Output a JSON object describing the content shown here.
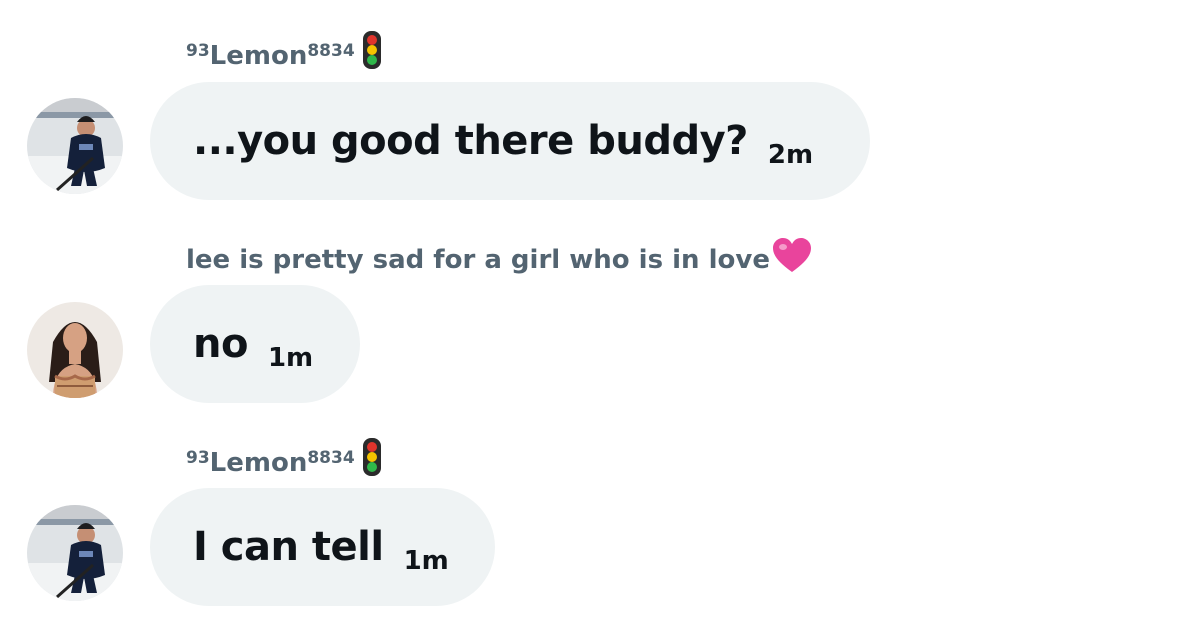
{
  "messages": [
    {
      "sender": {
        "prefix": "93",
        "name": "Lemon",
        "suffix": "8834",
        "emoji": "traffic-light-icon"
      },
      "avatar": "hockey-player-avatar",
      "text": "...you good there buddy?",
      "time": "2m"
    },
    {
      "sender": {
        "name": "lee is pretty sad for a girl who is in love",
        "emoji": "pink-heart-icon"
      },
      "avatar": "woman-avatar",
      "text": "no",
      "time": "1m"
    },
    {
      "sender": {
        "prefix": "93",
        "name": "Lemon",
        "suffix": "8834",
        "emoji": "traffic-light-icon"
      },
      "avatar": "hockey-player-avatar",
      "text": "I can tell",
      "time": "1m"
    }
  ],
  "colors": {
    "bubble": "#eff3f4",
    "sender_text": "#536471",
    "message_text": "#0f1419",
    "heart": "#e9449c"
  }
}
